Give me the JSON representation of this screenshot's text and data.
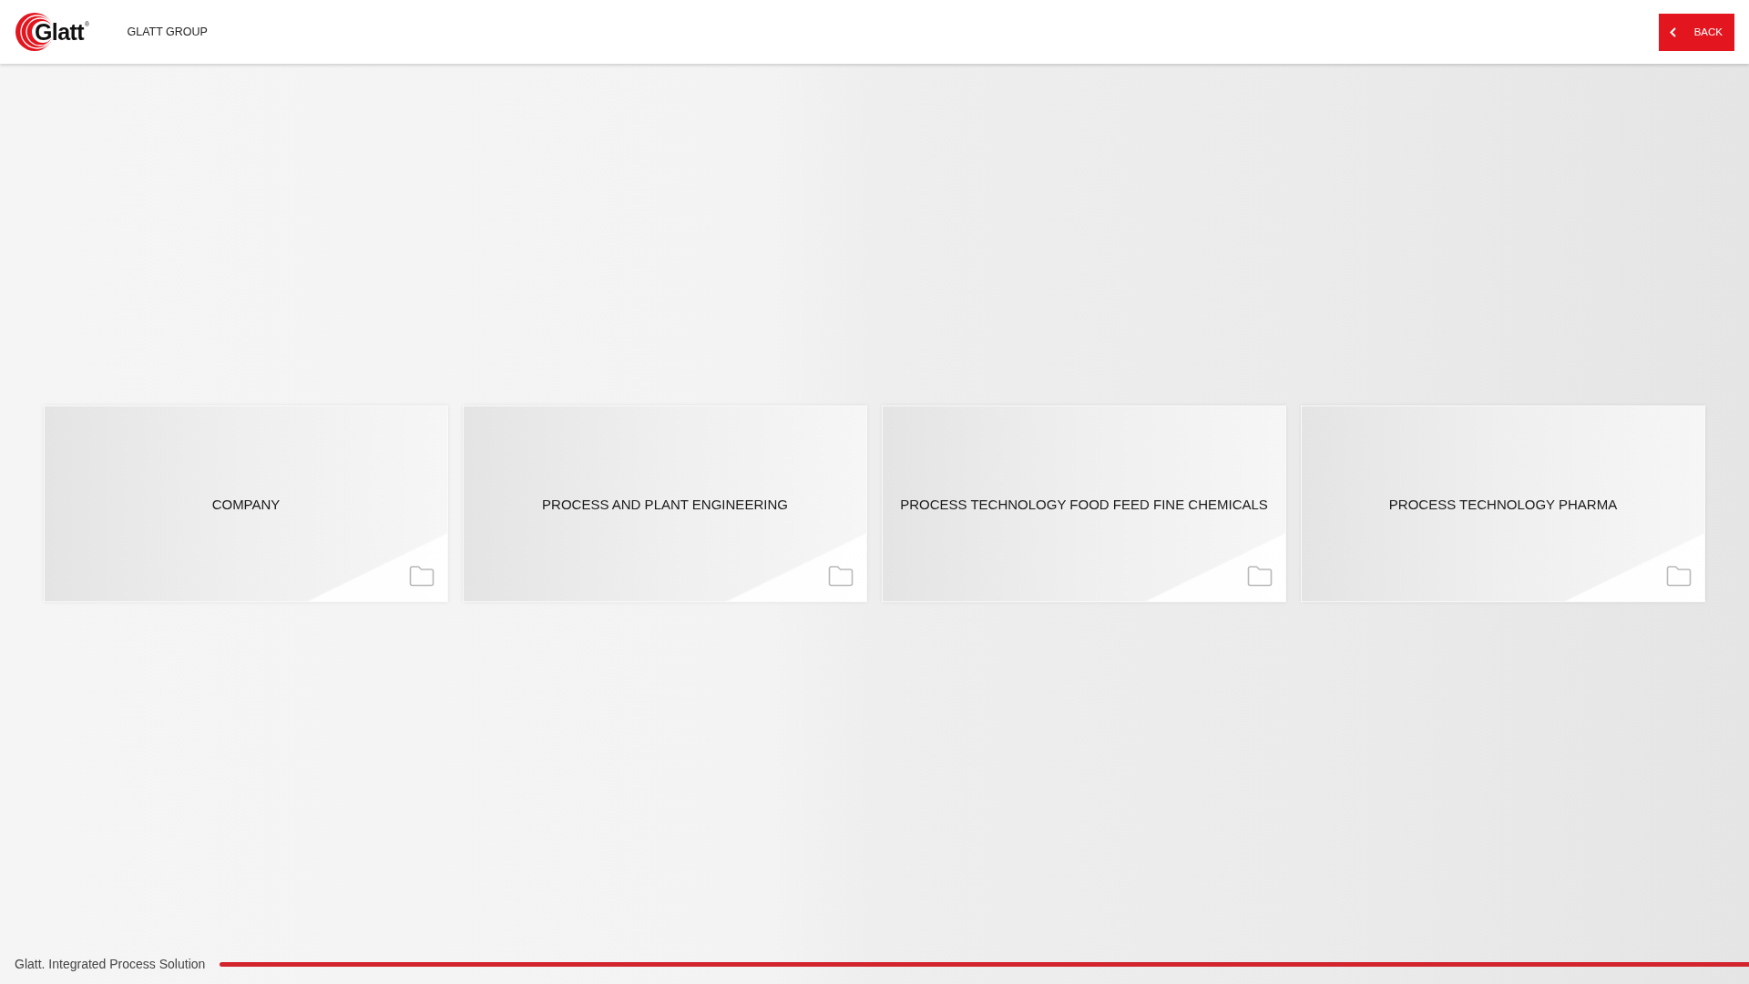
{
  "header": {
    "logo_text": "Glatt$^{®}$",
    "title": "GLATT GROUP",
    "back_button": {
      "label": "BACK"
    }
  },
  "tiles": [
    {
      "label": "COMPANY"
    },
    {
      "label": "PROCESS AND PLANT ENGINEERING"
    },
    {
      "label": "PROCESS TECHNOLOGY FOOD FEED FINE CHEMICALS"
    },
    {
      "label": "PROCESS TECHNOLOGY PHARMA"
    }
  ],
  "footer": {
    "tagline": "Glatt. Integrated Process Solution"
  }
}
